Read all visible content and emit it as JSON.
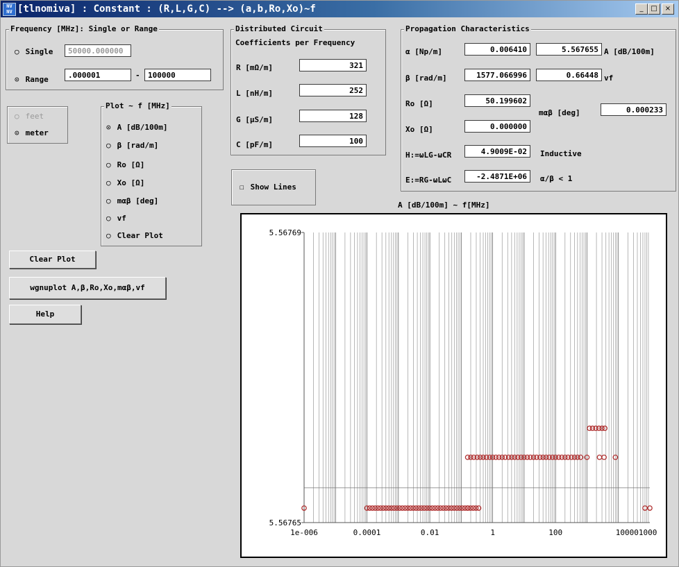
{
  "window": {
    "title": "[tlnomiva] : Constant : (R,L,G,C) --> (a,b,Ro,Xo)~f",
    "icon": "app-icon",
    "controls": [
      "_",
      "□",
      "×"
    ]
  },
  "frequency": {
    "legend": "Frequency [MHz]: Single or Range",
    "single_label": "Single",
    "single_value": "50000.000000",
    "range_label": "Range",
    "range_from": ".000001",
    "range_dash": "-",
    "range_to": "100000",
    "selected": "Range"
  },
  "units": {
    "feet": "feet",
    "meter": "meter",
    "selected": "meter"
  },
  "plot_select": {
    "legend": "Plot ~ f [MHz]",
    "options": [
      "A [dB/100m]",
      "β [rad/m]",
      "Ro [Ω]",
      "Xo [Ω]",
      "mαβ [deg]",
      "vf",
      "Clear Plot"
    ],
    "selected": "A [dB/100m]"
  },
  "buttons": {
    "clear_plot": "Clear Plot",
    "wgnuplot": "wgnuplot A,β,Ro,Xo,mαβ,vf",
    "help": "Help"
  },
  "circuit": {
    "legend": "Distributed Circuit",
    "subtitle": "Coefficients per Frequency",
    "rows": [
      {
        "label": "R [mΩ/m]",
        "value": "321"
      },
      {
        "label": "L [nH/m]",
        "value": "252"
      },
      {
        "label": "G [µS/m]",
        "value": "128"
      },
      {
        "label": "C [pF/m]",
        "value": "100"
      }
    ]
  },
  "show_lines": {
    "label": "Show Lines",
    "checked": false
  },
  "propagation": {
    "legend": "Propagation Characteristics",
    "alpha_label": "α [Np/m]",
    "alpha_value": "0.006410",
    "A_value": "5.567655",
    "A_label": "A [dB/100m]",
    "beta_label": "β [rad/m]",
    "beta_value": "1577.066996",
    "vf_value": "0.66448",
    "vf_label": "vf",
    "ro_label": "Ro [Ω]",
    "ro_value": "50.199602",
    "mab_label": "mαβ [deg]",
    "mab_value": "0.000233",
    "xo_label": "Xo [Ω]",
    "xo_value": "0.000000",
    "h_label": "H:=ωLG-ωCR",
    "h_value": "4.9009E-02",
    "h_note": "Inductive",
    "e_label": "E:=RG-ωLωC",
    "e_value": "-2.4871E+06",
    "e_note": "α/β < 1"
  },
  "chart_title": "A [dB/100m] ~ f[MHz]",
  "chart_data": {
    "type": "scatter",
    "title": "A [dB/100m] ~ f[MHz]",
    "x_scale": "log",
    "xlim": [
      1e-06,
      100000
    ],
    "ylim": [
      5.56765,
      5.56769
    ],
    "y_ticks": [
      "5.56769",
      "5.56765"
    ],
    "x_ticks": [
      "1e-006",
      "0.0001",
      "0.01",
      "1",
      "100",
      "10000100000"
    ],
    "grid": true,
    "marker": "open-circle",
    "color": "#b03030",
    "series": [
      {
        "x": [
          1e-06,
          0.0001,
          0.000122,
          0.000149,
          0.000182,
          0.000222,
          0.000271,
          0.000331,
          0.000404,
          0.000493,
          0.000602,
          0.000735,
          0.000897,
          0.001096,
          0.001338,
          0.001634,
          0.001995,
          0.002436,
          0.002974,
          0.003631,
          0.004434,
          0.005414,
          0.006611,
          0.008072,
          0.009856,
          0.012035,
          0.014696,
          0.017945,
          0.021912,
          0.026755,
          0.03267,
          0.039893,
          0.048713,
          0.059483,
          0.072633,
          0.088691,
          0.108298,
          0.132241,
          0.161477,
          0.197177,
          0.240767,
          0.293996,
          0.358993,
          0.16,
          70000,
          100000
        ],
        "y": [
          5.567652,
          5.567652,
          5.567652,
          5.567652,
          5.567652,
          5.567652,
          5.567652,
          5.567652,
          5.567652,
          5.567652,
          5.567652,
          5.567652,
          5.567652,
          5.567652,
          5.567652,
          5.567652,
          5.567652,
          5.567652,
          5.567652,
          5.567652,
          5.567652,
          5.567652,
          5.567652,
          5.567652,
          5.567652,
          5.567652,
          5.567652,
          5.567652,
          5.567652,
          5.567652,
          5.567652,
          5.567652,
          5.567652,
          5.567652,
          5.567652,
          5.567652,
          5.567652,
          5.567652,
          5.567652,
          5.567652,
          5.567652,
          5.567652,
          5.567652,
          5.567652,
          5.567652,
          5.567652
        ]
      },
      {
        "x": [
          0.16,
          0.2,
          0.25,
          0.32,
          0.4,
          0.5,
          0.63,
          0.8,
          1.0,
          1.26,
          1.58,
          2.0,
          2.5,
          3.2,
          4.0,
          5.0,
          6.3,
          8.0,
          10,
          12.6,
          15.8,
          20,
          25,
          32,
          40,
          50,
          63,
          80,
          100,
          126,
          158,
          200,
          250,
          320,
          400,
          500,
          630,
          1000,
          2500,
          3500,
          8000
        ],
        "y": [
          5.567659,
          5.567659,
          5.567659,
          5.567659,
          5.567659,
          5.567659,
          5.567659,
          5.567659,
          5.567659,
          5.567659,
          5.567659,
          5.567659,
          5.567659,
          5.567659,
          5.567659,
          5.567659,
          5.567659,
          5.567659,
          5.567659,
          5.567659,
          5.567659,
          5.567659,
          5.567659,
          5.567659,
          5.567659,
          5.567659,
          5.567659,
          5.567659,
          5.567659,
          5.567659,
          5.567659,
          5.567659,
          5.567659,
          5.567659,
          5.567659,
          5.567659,
          5.567659,
          5.567659,
          5.567659,
          5.567659,
          5.567659
        ]
      },
      {
        "x": [
          1200,
          1500,
          1900,
          2400,
          3000,
          3700
        ],
        "y": [
          5.567663,
          5.567663,
          5.567663,
          5.567663,
          5.567663,
          5.567663
        ]
      }
    ]
  }
}
